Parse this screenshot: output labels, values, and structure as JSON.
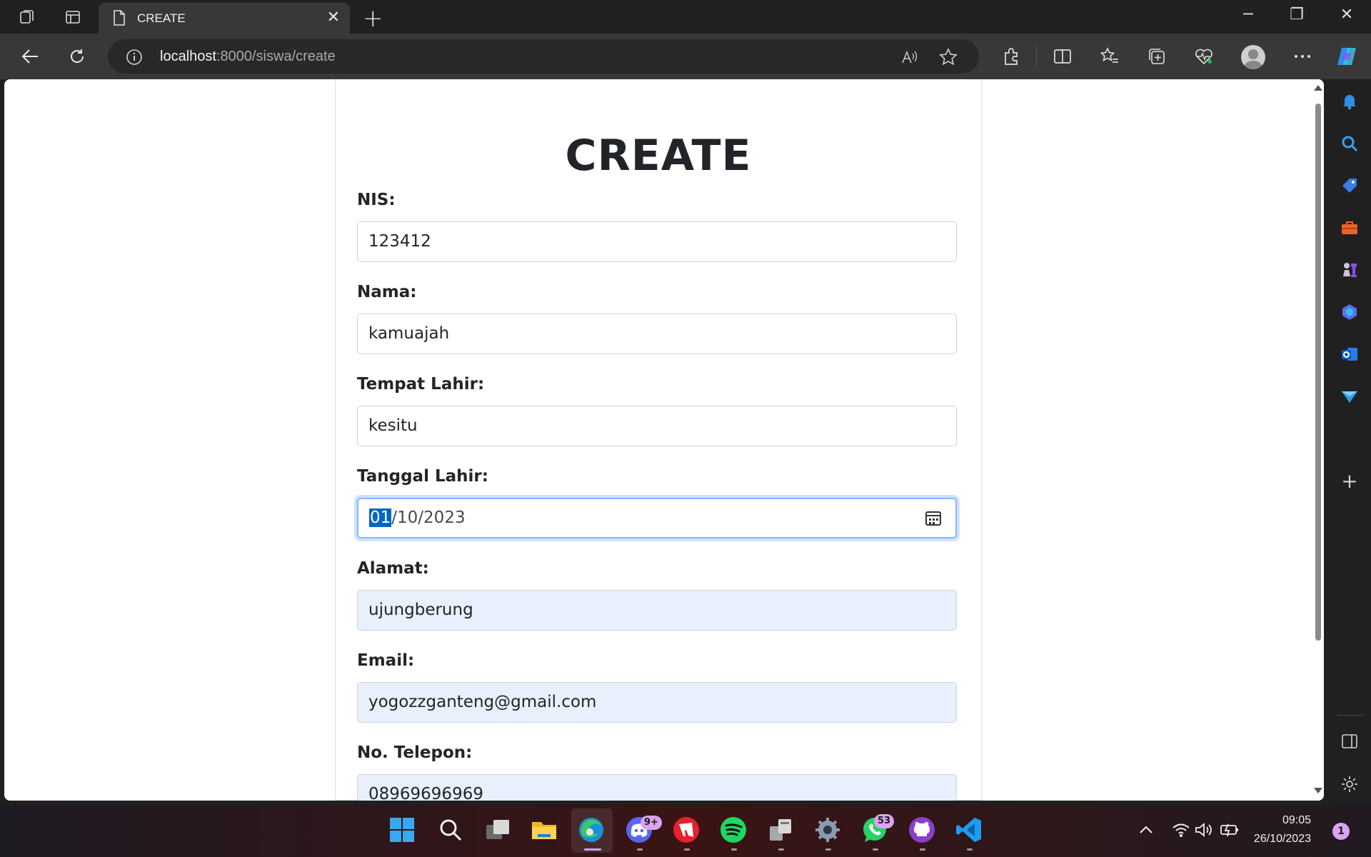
{
  "browser": {
    "tab_title": "CREATE",
    "tab_close": "✕",
    "new_tab": "+",
    "url_host": "localhost",
    "url_path": ":8000/siswa/create"
  },
  "page": {
    "title": "CREATE",
    "fields": [
      {
        "label": "NIS:",
        "value": "123412"
      },
      {
        "label": "Nama:",
        "value": "kamuajah"
      },
      {
        "label": "Tempat Lahir:",
        "value": "kesitu"
      },
      {
        "label": "Tanggal Lahir:",
        "value_selected": "01",
        "value_rest": "/10/2023"
      },
      {
        "label": "Alamat:",
        "value": "ujungberung"
      },
      {
        "label": "Email:",
        "value": "yogozzganteng@gmail.com"
      },
      {
        "label": "No. Telepon:",
        "value": "08969696969"
      }
    ]
  },
  "taskbar": {
    "discord_badge": "9+",
    "whatsapp_badge": "53",
    "time": "09:05",
    "date": "26/10/2023",
    "notification_count": "1"
  },
  "colors": {
    "accent": "#0067c0",
    "autofill_bg": "#e8f0fe",
    "focus_border": "#86b7fe"
  }
}
